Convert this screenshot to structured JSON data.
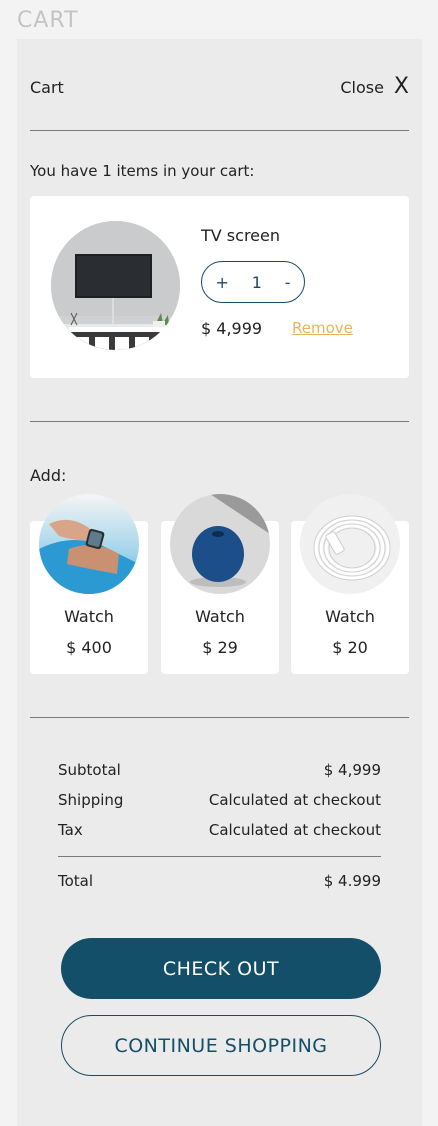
{
  "page": {
    "heading": "CART"
  },
  "panel": {
    "title": "Cart",
    "close_label": "Close",
    "close_glyph": "X",
    "items_text": "You have 1 items in your cart:"
  },
  "cart_item": {
    "title": "TV screen",
    "qty_plus": "+",
    "qty_value": "1",
    "qty_minus": "-",
    "price": "$ 4,999",
    "remove_label": "Remove",
    "image_icon": "tv-screen-image"
  },
  "addons": {
    "label": "Add:",
    "items": [
      {
        "name": "Watch",
        "price": "$ 400",
        "image_icon": "smartwatch-image"
      },
      {
        "name": "Watch",
        "price": "$ 29",
        "image_icon": "smart-speaker-image"
      },
      {
        "name": "Watch",
        "price": "$ 20",
        "image_icon": "cable-image"
      }
    ]
  },
  "summary": {
    "subtotal_label": "Subtotal",
    "subtotal_value": "$ 4,999",
    "shipping_label": "Shipping",
    "shipping_value": "Calculated at checkout",
    "tax_label": "Tax",
    "tax_value": "Calculated at checkout",
    "total_label": "Total",
    "total_value": "$ 4.999"
  },
  "actions": {
    "checkout_label": "CHECK OUT",
    "continue_label": "CONTINUE SHOPPING"
  },
  "colors": {
    "primary": "#144f69",
    "accent_remove": "#e7b45a",
    "panel_bg": "#ebebeb",
    "page_bg": "#f3f3f3"
  }
}
